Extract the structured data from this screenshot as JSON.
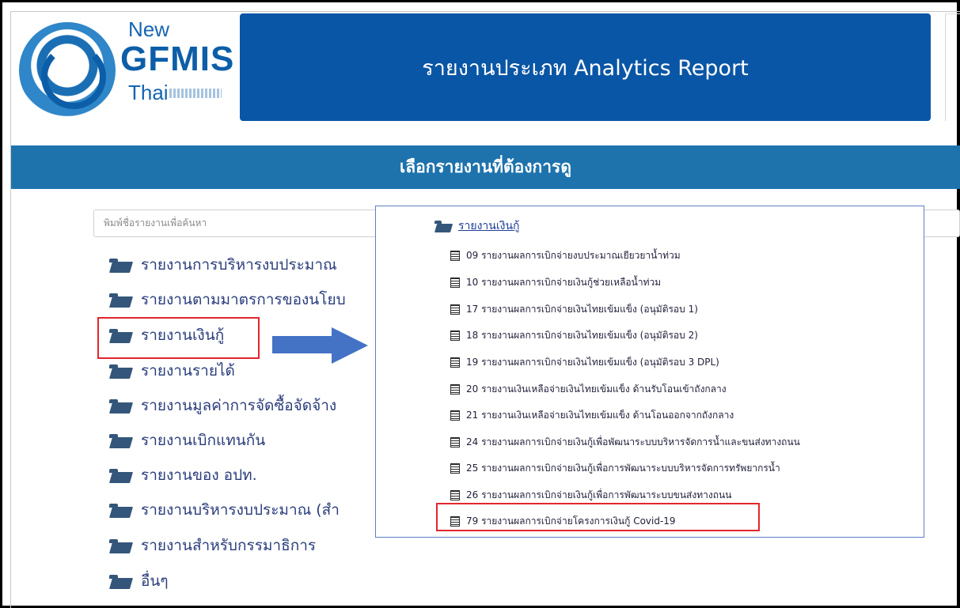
{
  "header": {
    "logo_new": "New",
    "logo_gfmis": "GFMIS",
    "logo_thai": "Thai",
    "title": "รายงานประเภท Analytics Report"
  },
  "select_bar": {
    "title": "เลือกรายงานที่ต้องการดู"
  },
  "search": {
    "placeholder": "พิมพ์ชื่อรายงานเพื่อค้นหา"
  },
  "folders": [
    "รายงานการบริหารงบประมาณ",
    "รายงานตามมาตรการของนโยบ",
    "รายงานเงินกู้",
    "รายงานรายได้",
    "รายงานมูลค่าการจัดซื้อจัดจ้าง",
    "รายงานเบิกแทนกัน",
    "รายงานของ อปท.",
    "รายงานบริหารงบประมาณ (สำ",
    "รายงานสำหรับกรรมาธิการ",
    "อื่นๆ"
  ],
  "popup": {
    "folder_label": "รายงานเงินกู้",
    "reports": [
      "09 รายงานผลการเบิกจ่ายงบประมาณเยียวยาน้ำท่วม",
      "10 รายงานผลการเบิกจ่ายเงินกู้ช่วยเหลือน้ำท่วม",
      "17 รายงานผลการเบิกจ่ายเงินไทยเข้มแข็ง (อนุมัติรอบ 1)",
      "18 รายงานผลการเบิกจ่ายเงินไทยเข้มแข็ง (อนุมัติรอบ 2)",
      "19 รายงานผลการเบิกจ่ายเงินไทยเข้มแข็ง (อนุมัติรอบ 3 DPL)",
      "20 รายงานเงินเหลือจ่ายเงินไทยเข้มแข็ง ด้านรับโอนเข้าถังกลาง",
      "21 รายงานเงินเหลือจ่ายเงินไทยเข้มแข็ง ด้านโอนออกจากถังกลาง",
      "24 รายงานผลการเบิกจ่ายเงินกู้เพื่อพัฒนาระบบบริหารจัดการน้ำและขนส่งทางถนน",
      "25 รายงานผลการเบิกจ่ายเงินกู้เพื่อการพัฒนาระบบบริหารจัดการทรัพยากรน้ำ",
      "26 รายงานผลการเบิกจ่ายเงินกู้เพื่อการพัฒนาระบบขนส่งทางถนน",
      "79 รายงานผลการเบิกจ่ายโครงการเงินกู้ Covid-19"
    ]
  },
  "colors": {
    "header_bg": "#0a56a6",
    "select_bar_bg": "#1e73ad",
    "highlight": "#e2262d",
    "arrow": "#4472c4"
  }
}
